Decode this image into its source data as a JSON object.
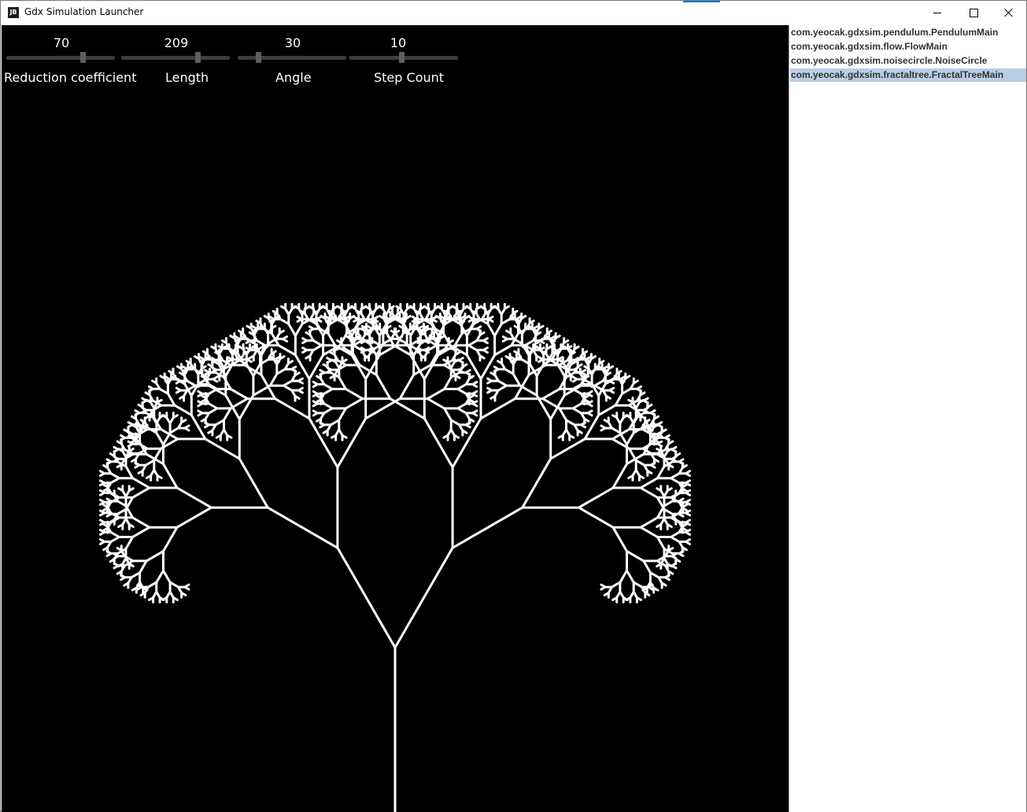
{
  "window": {
    "title": "Gdx Simulation Launcher",
    "icon_text": "JB",
    "controls": [
      "minimize-icon",
      "maximize-icon",
      "close-icon"
    ]
  },
  "sliders": [
    {
      "value": "70",
      "label": "Reduction coefficient",
      "level": 0.7
    },
    {
      "value": "209",
      "label": "Length",
      "level": 0.7
    },
    {
      "value": "30",
      "label": "Angle",
      "level": 0.19
    },
    {
      "value": "10",
      "label": "Step Count",
      "level": 0.48
    }
  ],
  "simulations": {
    "items": [
      {
        "label": "com.yeocak.gdxsim.pendulum.PendulumMain",
        "selected": false
      },
      {
        "label": "com.yeocak.gdxsim.flow.FlowMain",
        "selected": false
      },
      {
        "label": "com.yeocak.gdxsim.noisecircle.NoiseCircle",
        "selected": false
      },
      {
        "label": "com.yeocak.gdxsim.fractaltree.FractalTreeMain",
        "selected": true
      }
    ],
    "selected_color": "#b8cfe5"
  },
  "colors": {
    "canvas": "#000000",
    "tree": "#ffffff",
    "slider_track": "#3c3c3c",
    "slider_knob": "#5e5e5e"
  }
}
